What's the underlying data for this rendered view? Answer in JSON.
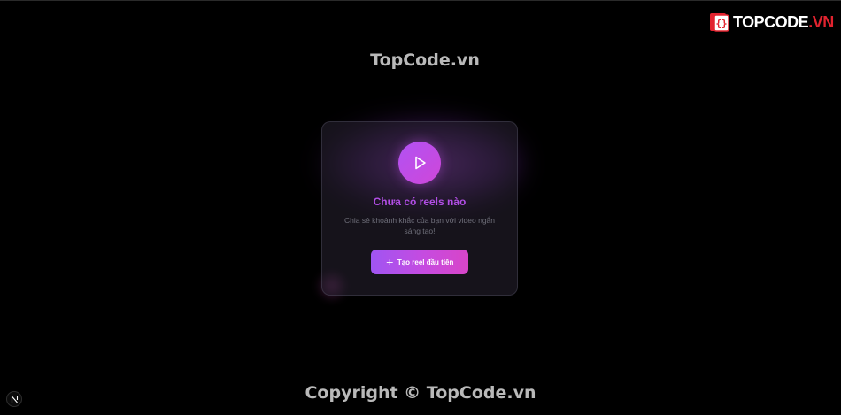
{
  "watermark": {
    "title": "TopCode.vn",
    "logo_brand": "TOPCODE",
    "logo_suffix": ".VN",
    "logo_icon": "topcode-logo-icon"
  },
  "empty_state": {
    "icon": "play-icon",
    "title": "Chưa có reels nào",
    "description": "Chia sẻ khoảnh khắc của bạn với video ngắn sáng tạo!",
    "button_icon": "plus-icon",
    "button_label": "Tạo reel đầu tiên"
  },
  "footer": {
    "copyright": "Copyright © TopCode.vn"
  },
  "dev_badge": {
    "icon": "nextjs-icon",
    "label": "N"
  },
  "colors": {
    "background": "#000000",
    "accent_purple": "#b24ee6",
    "button_gradient_start": "#a055f2",
    "button_gradient_end": "#d845c8",
    "logo_red": "#e2232f"
  }
}
